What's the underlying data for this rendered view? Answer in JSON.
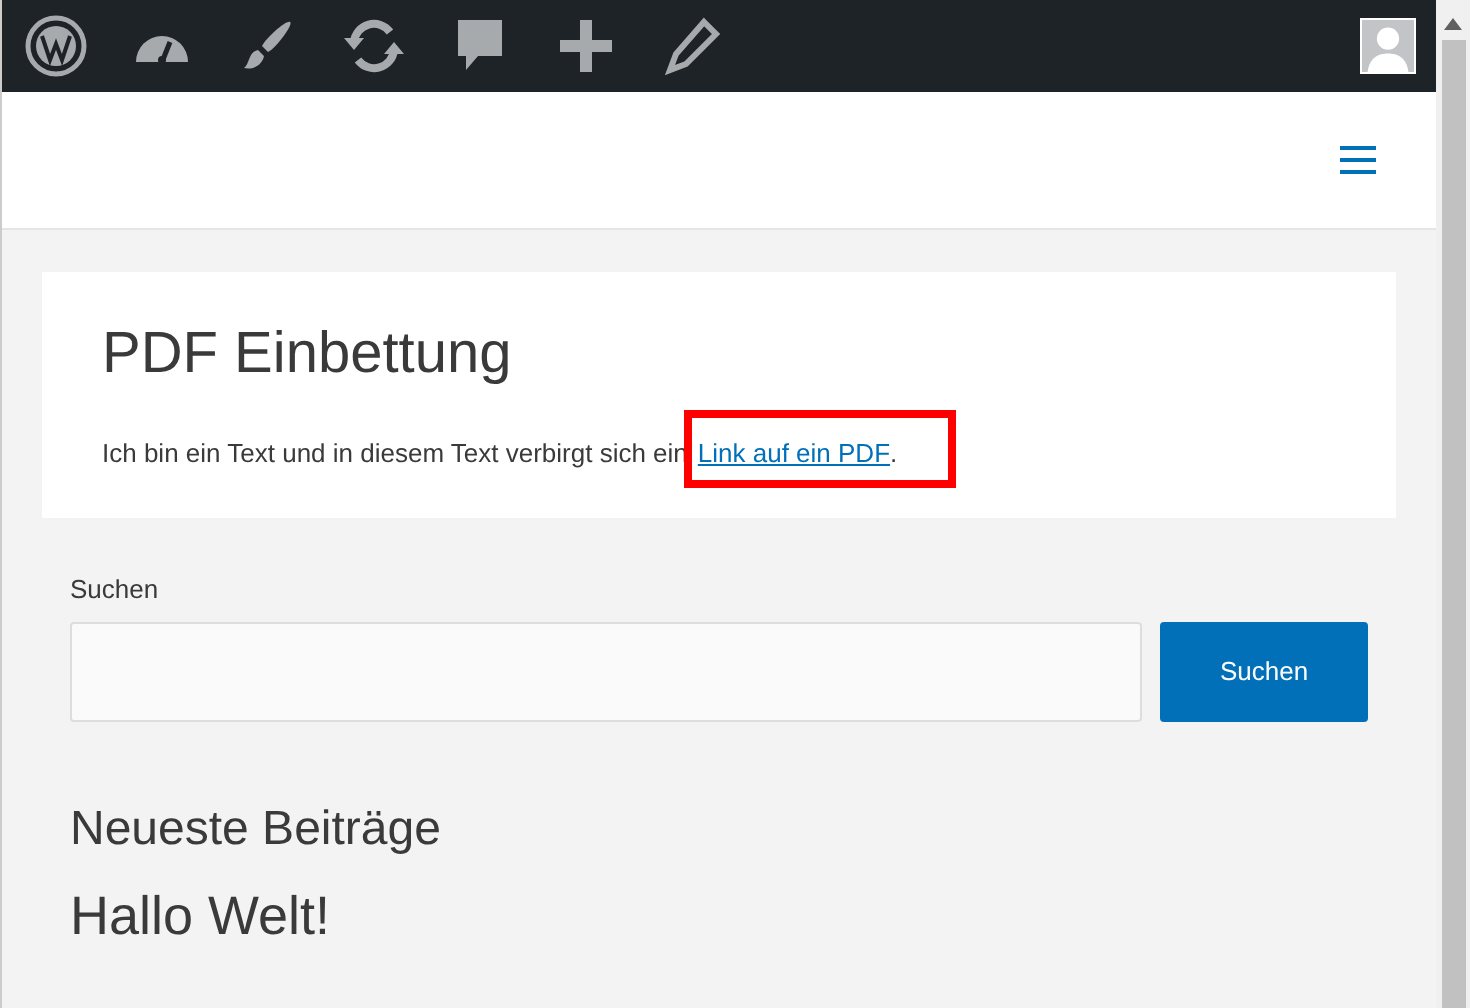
{
  "post": {
    "title": "PDF Einbettung",
    "text_before": "Ich bin ein Text und in diesem Text verbirgt sich ein",
    "link": {
      "label": "Link auf ein PDF",
      "highlighted": true
    },
    "text_after": "."
  },
  "search": {
    "label": "Suchen",
    "button": "Suchen"
  },
  "recent_posts": {
    "heading": "Neueste Beiträge",
    "items": [
      "Hallo Welt!"
    ]
  }
}
